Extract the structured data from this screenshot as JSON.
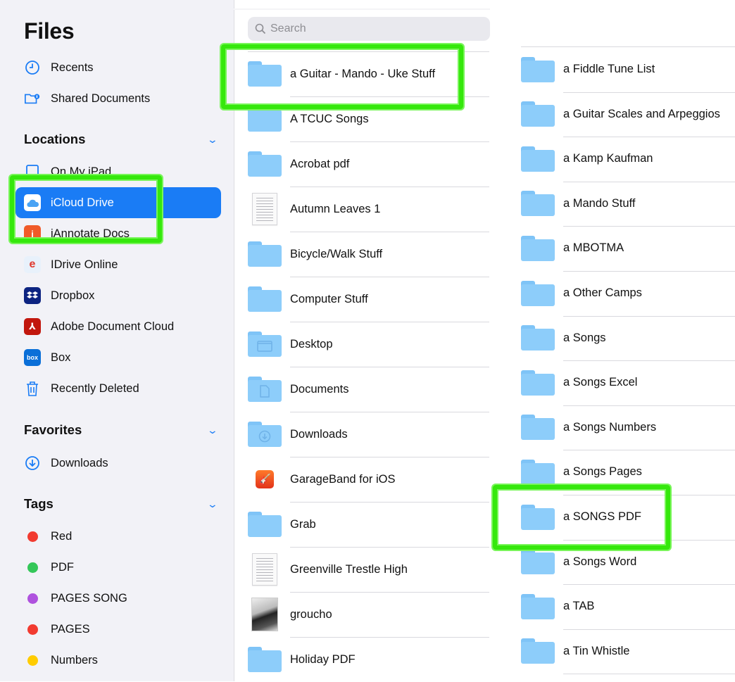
{
  "sidebar": {
    "title": "Files",
    "top_items": [
      {
        "label": "Recents",
        "icon": "clock-icon"
      },
      {
        "label": "Shared Documents",
        "icon": "shared-folder-icon"
      }
    ],
    "locations": {
      "header": "Locations",
      "items": [
        {
          "label": "On My iPad",
          "icon": "ipad-icon"
        },
        {
          "label": "iCloud Drive",
          "icon": "icloud-icon",
          "selected": true
        },
        {
          "label": "iAnnotate Docs",
          "icon": "iannotate-icon"
        },
        {
          "label": "IDrive Online",
          "icon": "idrive-icon"
        },
        {
          "label": "Dropbox",
          "icon": "dropbox-icon"
        },
        {
          "label": "Adobe Document Cloud",
          "icon": "adobe-icon"
        },
        {
          "label": "Box",
          "icon": "box-icon"
        },
        {
          "label": "Recently Deleted",
          "icon": "trash-icon"
        }
      ]
    },
    "favorites": {
      "header": "Favorites",
      "items": [
        {
          "label": "Downloads",
          "icon": "download-circle-icon"
        }
      ]
    },
    "tags": {
      "header": "Tags",
      "items": [
        {
          "label": "Red",
          "color": "#f23b30"
        },
        {
          "label": "PDF",
          "color": "#34c759"
        },
        {
          "label": "PAGES SONG",
          "color": "#af52de"
        },
        {
          "label": "PAGES",
          "color": "#f23b30"
        },
        {
          "label": "Numbers",
          "color": "#ffcc00"
        }
      ]
    }
  },
  "search": {
    "placeholder": "Search"
  },
  "middle_list": [
    {
      "name": "a Guitar - Mando - Uke Stuff",
      "kind": "folder"
    },
    {
      "name": "A TCUC Songs",
      "kind": "folder"
    },
    {
      "name": "Acrobat pdf",
      "kind": "folder"
    },
    {
      "name": "Autumn Leaves 1",
      "kind": "document"
    },
    {
      "name": "Bicycle/Walk Stuff",
      "kind": "folder"
    },
    {
      "name": "Computer Stuff",
      "kind": "folder"
    },
    {
      "name": "Desktop",
      "kind": "folder-desktop"
    },
    {
      "name": "Documents",
      "kind": "folder-documents"
    },
    {
      "name": "Downloads",
      "kind": "folder-downloads"
    },
    {
      "name": "GarageBand for iOS",
      "kind": "app-garageband"
    },
    {
      "name": "Grab",
      "kind": "folder"
    },
    {
      "name": "Greenville Trestle High",
      "kind": "document"
    },
    {
      "name": "groucho",
      "kind": "image"
    },
    {
      "name": "Holiday PDF",
      "kind": "folder"
    }
  ],
  "right_list": [
    {
      "name": "a Fiddle Tune List"
    },
    {
      "name": "a Guitar Scales and Arpeggios"
    },
    {
      "name": "a Kamp Kaufman"
    },
    {
      "name": "a Mando Stuff"
    },
    {
      "name": "a MBOTMA"
    },
    {
      "name": "a Other Camps"
    },
    {
      "name": "a Songs"
    },
    {
      "name": "a Songs Excel"
    },
    {
      "name": "a Songs Numbers"
    },
    {
      "name": "a Songs Pages"
    },
    {
      "name": "a SONGS PDF"
    },
    {
      "name": "a Songs Word"
    },
    {
      "name": "a TAB"
    },
    {
      "name": "a Tin Whistle"
    }
  ],
  "colors": {
    "accent": "#1a7cf5",
    "folder": "#8dcdfa",
    "highlight": "#35e80c"
  }
}
